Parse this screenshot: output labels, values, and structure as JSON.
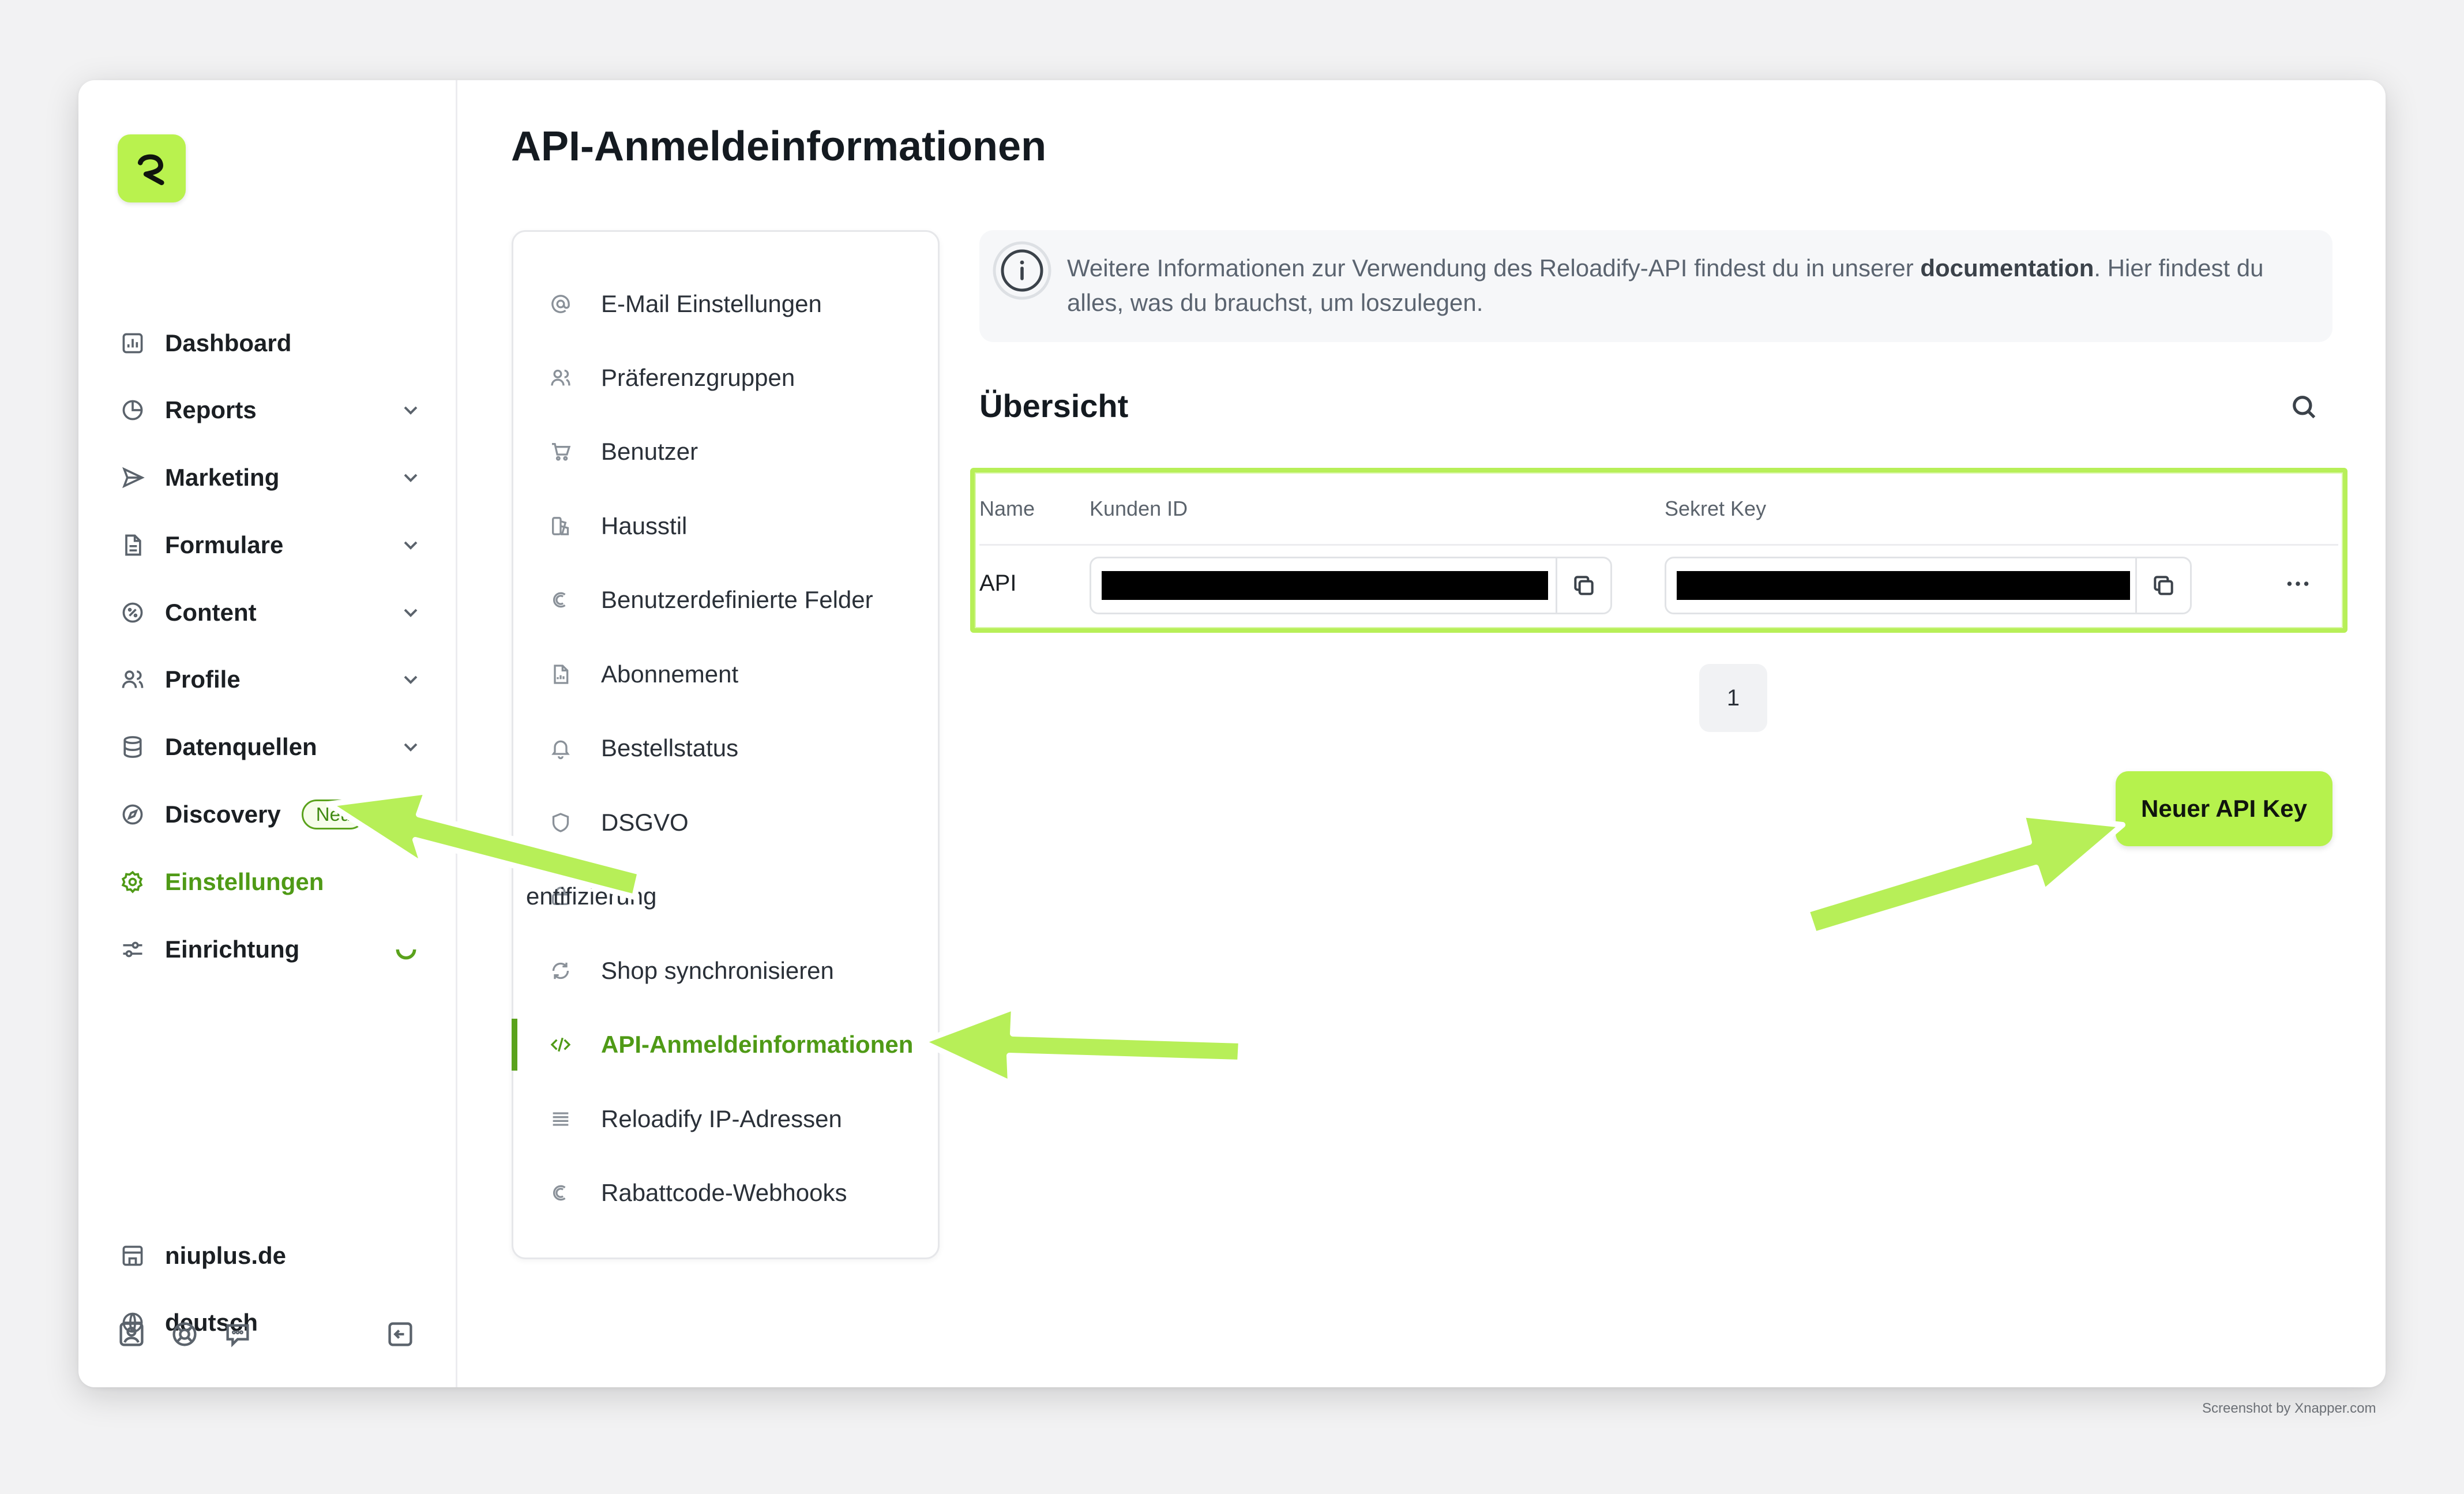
{
  "page": {
    "title": "API-Anmeldeinformationen"
  },
  "sidebar": {
    "items": [
      {
        "label": "Dashboard",
        "icon": "bar-chart-icon",
        "chevron": false
      },
      {
        "label": "Reports",
        "icon": "pie-chart-icon",
        "chevron": true
      },
      {
        "label": "Marketing",
        "icon": "send-icon",
        "chevron": true
      },
      {
        "label": "Formulare",
        "icon": "document-icon",
        "chevron": true
      },
      {
        "label": "Content",
        "icon": "badge-percent-icon",
        "chevron": true
      },
      {
        "label": "Profile",
        "icon": "users-icon",
        "chevron": true
      },
      {
        "label": "Datenquellen",
        "icon": "database-icon",
        "chevron": true
      },
      {
        "label": "Discovery",
        "icon": "compass-icon",
        "chevron": true,
        "badge": "Neu"
      },
      {
        "label": "Einstellungen",
        "icon": "gear-icon",
        "active": true
      },
      {
        "label": "Einrichtung",
        "icon": "sliders-icon"
      }
    ],
    "shop": "niuplus.de",
    "language": "deutsch",
    "footer_icons": [
      "account-icon",
      "help-buoy-icon",
      "chat-icon",
      "collapse-sidebar-icon"
    ]
  },
  "submenu": {
    "items": [
      {
        "label": "E-Mail Einstellungen",
        "icon": "at-icon"
      },
      {
        "label": "Präferenzgruppen",
        "icon": "users-icon"
      },
      {
        "label": "Benutzer",
        "icon": "cart-icon"
      },
      {
        "label": "Hausstil",
        "icon": "palette-icon"
      },
      {
        "label": "Benutzerdefinierte Felder",
        "icon": "custom-icon"
      },
      {
        "label": "Abonnement",
        "icon": "file-chart-icon"
      },
      {
        "label": "Bestellstatus",
        "icon": "bell-icon"
      },
      {
        "label": "DSGVO",
        "icon": "shield-icon"
      },
      {
        "label": "Authentifizierung",
        "icon": "key-icon",
        "visible_label": "entifizierung"
      },
      {
        "label": "Shop synchronisieren",
        "icon": "refresh-icon"
      },
      {
        "label": "API-Anmeldeinformationen",
        "icon": "code-icon",
        "active": true
      },
      {
        "label": "Reloadify IP-Adressen",
        "icon": "list-icon"
      },
      {
        "label": "Rabattcode-Webhooks",
        "icon": "custom-icon"
      }
    ]
  },
  "info": {
    "text_before": "Weitere Informationen zur Verwendung des Reloadify-API findest du in unserer ",
    "link": "documentation",
    "text_after": ". Hier findest du alles, was du brauchst, um loszulegen."
  },
  "overview": {
    "title": "Übersicht",
    "columns": [
      "Name",
      "Kunden ID",
      "Sekret Key"
    ],
    "rows": [
      {
        "name": "API"
      }
    ],
    "pagination": {
      "current": "1"
    },
    "new_button": "Neuer API Key"
  },
  "colors": {
    "accent": "#b6f24d",
    "accent_text": "#4f9a16",
    "annotation_arrow": "#b7ef58"
  },
  "watermark": "Screenshot by Xnapper.com"
}
